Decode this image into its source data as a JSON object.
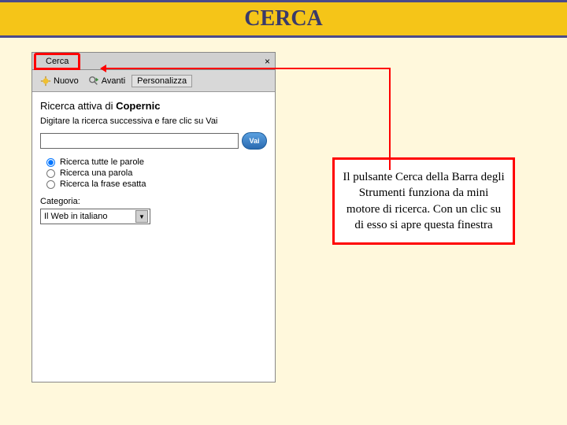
{
  "header": {
    "title": "CERCA"
  },
  "panel": {
    "tab_label": "Cerca",
    "close_icon": "×",
    "toolbar": {
      "nuovo": "Nuovo",
      "avanti": "Avanti",
      "personalizza": "Personalizza"
    },
    "heading_prefix": "Ricerca attiva di ",
    "heading_brand": "Copernic",
    "instruction": "Digitare la ricerca successiva e fare clic su Vai",
    "search_value": "",
    "vai_label": "Vai",
    "radios": {
      "r1": "Ricerca tutte le parole",
      "r2": "Ricerca una parola",
      "r3": "Ricerca la frase esatta"
    },
    "category_label": "Categoria:",
    "category_value": "Il Web in italiano"
  },
  "callout": {
    "text": "Il pulsante Cerca della Barra degli Strumenti funziona da mini motore di ricerca. Con un clic su di esso si apre questa finestra"
  }
}
